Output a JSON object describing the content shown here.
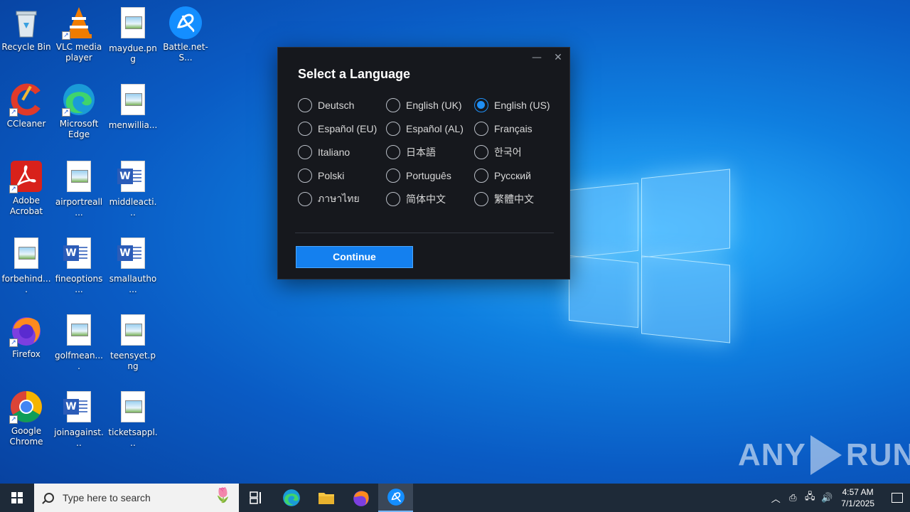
{
  "desktop": {
    "icons": [
      {
        "label": "Recycle Bin",
        "icon": "recycle-bin-icon"
      },
      {
        "label": "VLC media player",
        "icon": "vlc-icon"
      },
      {
        "label": "maydue.png",
        "icon": "image-file-icon"
      },
      {
        "label": "Battle.net-S...",
        "icon": "battlenet-icon"
      },
      {
        "label": "CCleaner",
        "icon": "ccleaner-icon"
      },
      {
        "label": "Microsoft Edge",
        "icon": "edge-icon"
      },
      {
        "label": "menwillia...",
        "icon": "image-file-icon"
      },
      {
        "label": "Adobe Acrobat",
        "icon": "acrobat-icon"
      },
      {
        "label": "airportreall...",
        "icon": "image-file-icon"
      },
      {
        "label": "middleacti...",
        "icon": "word-file-icon"
      },
      {
        "label": "forbehind....",
        "icon": "image-file-icon"
      },
      {
        "label": "fineoptions...",
        "icon": "word-file-icon"
      },
      {
        "label": "smallautho...",
        "icon": "word-file-icon"
      },
      {
        "label": "Firefox",
        "icon": "firefox-icon"
      },
      {
        "label": "golfmean....",
        "icon": "image-file-icon"
      },
      {
        "label": "teensyet.png",
        "icon": "image-file-icon"
      },
      {
        "label": "Google Chrome",
        "icon": "chrome-icon"
      },
      {
        "label": "joinagainst...",
        "icon": "word-file-icon"
      },
      {
        "label": "ticketsappl...",
        "icon": "image-file-icon"
      }
    ]
  },
  "dialog": {
    "title": "Select a Language",
    "languages": [
      {
        "label": "Deutsch",
        "selected": false
      },
      {
        "label": "English (UK)",
        "selected": false
      },
      {
        "label": "English (US)",
        "selected": true
      },
      {
        "label": "Español (EU)",
        "selected": false
      },
      {
        "label": "Español (AL)",
        "selected": false
      },
      {
        "label": "Français",
        "selected": false
      },
      {
        "label": "Italiano",
        "selected": false
      },
      {
        "label": "日本語",
        "selected": false
      },
      {
        "label": "한국어",
        "selected": false
      },
      {
        "label": "Polski",
        "selected": false
      },
      {
        "label": "Português",
        "selected": false
      },
      {
        "label": "Русский",
        "selected": false
      },
      {
        "label": "ภาษาไทย",
        "selected": false
      },
      {
        "label": "简体中文",
        "selected": false
      },
      {
        "label": "繁體中文",
        "selected": false
      }
    ],
    "continue_label": "Continue",
    "minimize_glyph": "—",
    "close_glyph": "✕"
  },
  "watermark": {
    "left": "ANY",
    "right": "RUN"
  },
  "taskbar": {
    "search_placeholder": "Type here to search",
    "time": "4:57 AM",
    "date": "7/1/2025"
  },
  "colors": {
    "accent": "#1480ef",
    "dialog_bg": "#16181d",
    "taskbar_bg": "#1e2a38"
  }
}
